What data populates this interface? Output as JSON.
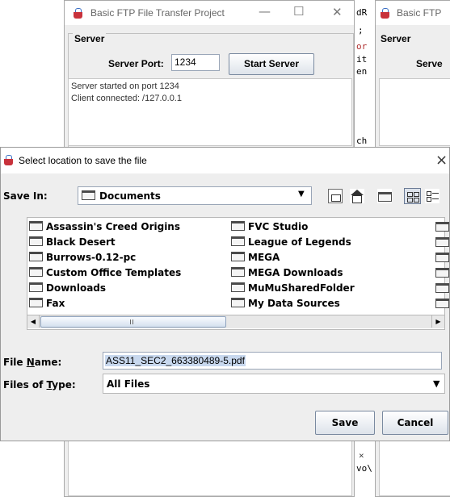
{
  "bg_window": {
    "title": "Basic FTP File Transfer Project",
    "section_label": "Server",
    "port_label": "Server Port:",
    "port_value": "1234",
    "start_button": "Start Server",
    "log": [
      "Server started on port 1234",
      "Client connected: /127.0.0.1"
    ]
  },
  "right_window": {
    "title": "Basic FTP",
    "section_label": "Server",
    "port_label_partial": "Serve"
  },
  "code_fragments": [
    "dR",
    ";",
    "or",
    "it",
    "en",
    "ch",
    "×",
    "vo\\"
  ],
  "dialog": {
    "title": "Select location to save the file",
    "save_in_label": "Save In:",
    "save_in_value": "Documents",
    "files_col1": [
      "Assassin's Creed Origins",
      "Black Desert",
      "Burrows-0.12-pc",
      "Custom Office Templates",
      "Downloads",
      "Fax"
    ],
    "files_col2": [
      "FVC Studio",
      "League of Legends",
      "MEGA",
      "MEGA Downloads",
      "MuMuSharedFolder",
      "My Data Sources"
    ],
    "file_name_label": "File Name:",
    "file_name_value": "ASS11_SEC2_663380489-5.pdf",
    "file_type_label": "Files of Type:",
    "file_type_value": "All Files",
    "save_button": "Save",
    "cancel_button": "Cancel",
    "close_glyph": "×"
  },
  "window_controls": {
    "minimize": "—",
    "maximize": "☐",
    "close": "✕"
  }
}
